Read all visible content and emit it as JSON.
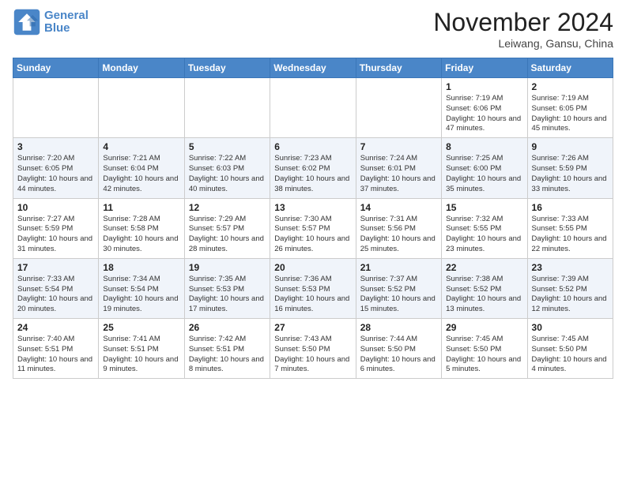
{
  "header": {
    "logo_line1": "General",
    "logo_line2": "Blue",
    "month_title": "November 2024",
    "location": "Leiwang, Gansu, China"
  },
  "days_of_week": [
    "Sunday",
    "Monday",
    "Tuesday",
    "Wednesday",
    "Thursday",
    "Friday",
    "Saturday"
  ],
  "weeks": [
    [
      {
        "day": "",
        "info": ""
      },
      {
        "day": "",
        "info": ""
      },
      {
        "day": "",
        "info": ""
      },
      {
        "day": "",
        "info": ""
      },
      {
        "day": "",
        "info": ""
      },
      {
        "day": "1",
        "info": "Sunrise: 7:19 AM\nSunset: 6:06 PM\nDaylight: 10 hours and 47 minutes."
      },
      {
        "day": "2",
        "info": "Sunrise: 7:19 AM\nSunset: 6:05 PM\nDaylight: 10 hours and 45 minutes."
      }
    ],
    [
      {
        "day": "3",
        "info": "Sunrise: 7:20 AM\nSunset: 6:05 PM\nDaylight: 10 hours and 44 minutes."
      },
      {
        "day": "4",
        "info": "Sunrise: 7:21 AM\nSunset: 6:04 PM\nDaylight: 10 hours and 42 minutes."
      },
      {
        "day": "5",
        "info": "Sunrise: 7:22 AM\nSunset: 6:03 PM\nDaylight: 10 hours and 40 minutes."
      },
      {
        "day": "6",
        "info": "Sunrise: 7:23 AM\nSunset: 6:02 PM\nDaylight: 10 hours and 38 minutes."
      },
      {
        "day": "7",
        "info": "Sunrise: 7:24 AM\nSunset: 6:01 PM\nDaylight: 10 hours and 37 minutes."
      },
      {
        "day": "8",
        "info": "Sunrise: 7:25 AM\nSunset: 6:00 PM\nDaylight: 10 hours and 35 minutes."
      },
      {
        "day": "9",
        "info": "Sunrise: 7:26 AM\nSunset: 5:59 PM\nDaylight: 10 hours and 33 minutes."
      }
    ],
    [
      {
        "day": "10",
        "info": "Sunrise: 7:27 AM\nSunset: 5:59 PM\nDaylight: 10 hours and 31 minutes."
      },
      {
        "day": "11",
        "info": "Sunrise: 7:28 AM\nSunset: 5:58 PM\nDaylight: 10 hours and 30 minutes."
      },
      {
        "day": "12",
        "info": "Sunrise: 7:29 AM\nSunset: 5:57 PM\nDaylight: 10 hours and 28 minutes."
      },
      {
        "day": "13",
        "info": "Sunrise: 7:30 AM\nSunset: 5:57 PM\nDaylight: 10 hours and 26 minutes."
      },
      {
        "day": "14",
        "info": "Sunrise: 7:31 AM\nSunset: 5:56 PM\nDaylight: 10 hours and 25 minutes."
      },
      {
        "day": "15",
        "info": "Sunrise: 7:32 AM\nSunset: 5:55 PM\nDaylight: 10 hours and 23 minutes."
      },
      {
        "day": "16",
        "info": "Sunrise: 7:33 AM\nSunset: 5:55 PM\nDaylight: 10 hours and 22 minutes."
      }
    ],
    [
      {
        "day": "17",
        "info": "Sunrise: 7:33 AM\nSunset: 5:54 PM\nDaylight: 10 hours and 20 minutes."
      },
      {
        "day": "18",
        "info": "Sunrise: 7:34 AM\nSunset: 5:54 PM\nDaylight: 10 hours and 19 minutes."
      },
      {
        "day": "19",
        "info": "Sunrise: 7:35 AM\nSunset: 5:53 PM\nDaylight: 10 hours and 17 minutes."
      },
      {
        "day": "20",
        "info": "Sunrise: 7:36 AM\nSunset: 5:53 PM\nDaylight: 10 hours and 16 minutes."
      },
      {
        "day": "21",
        "info": "Sunrise: 7:37 AM\nSunset: 5:52 PM\nDaylight: 10 hours and 15 minutes."
      },
      {
        "day": "22",
        "info": "Sunrise: 7:38 AM\nSunset: 5:52 PM\nDaylight: 10 hours and 13 minutes."
      },
      {
        "day": "23",
        "info": "Sunrise: 7:39 AM\nSunset: 5:52 PM\nDaylight: 10 hours and 12 minutes."
      }
    ],
    [
      {
        "day": "24",
        "info": "Sunrise: 7:40 AM\nSunset: 5:51 PM\nDaylight: 10 hours and 11 minutes."
      },
      {
        "day": "25",
        "info": "Sunrise: 7:41 AM\nSunset: 5:51 PM\nDaylight: 10 hours and 9 minutes."
      },
      {
        "day": "26",
        "info": "Sunrise: 7:42 AM\nSunset: 5:51 PM\nDaylight: 10 hours and 8 minutes."
      },
      {
        "day": "27",
        "info": "Sunrise: 7:43 AM\nSunset: 5:50 PM\nDaylight: 10 hours and 7 minutes."
      },
      {
        "day": "28",
        "info": "Sunrise: 7:44 AM\nSunset: 5:50 PM\nDaylight: 10 hours and 6 minutes."
      },
      {
        "day": "29",
        "info": "Sunrise: 7:45 AM\nSunset: 5:50 PM\nDaylight: 10 hours and 5 minutes."
      },
      {
        "day": "30",
        "info": "Sunrise: 7:45 AM\nSunset: 5:50 PM\nDaylight: 10 hours and 4 minutes."
      }
    ]
  ]
}
